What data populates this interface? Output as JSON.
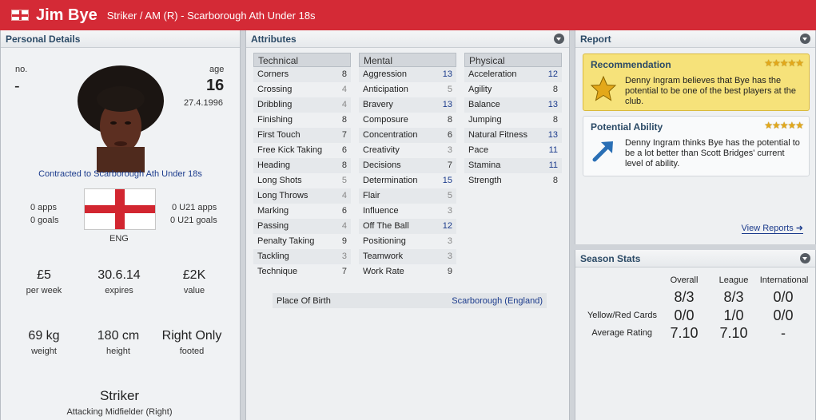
{
  "header": {
    "name": "Jim Bye",
    "subtitle": "Striker / AM (R) - Scarborough Ath Under 18s"
  },
  "personal": {
    "title": "Personal Details",
    "no_label": "no.",
    "no_value": "-",
    "age_label": "age",
    "age_value": "16",
    "dob": "27.4.1996",
    "contract": "Contracted to Scarborough Ath Under 18s",
    "apps": "0 apps",
    "goals": "0 goals",
    "u21_apps": "0 U21 apps",
    "u21_goals": "0 U21 goals",
    "nation": "ENG",
    "wage_value": "£5",
    "wage_label": "per week",
    "expires_value": "30.6.14",
    "expires_label": "expires",
    "value_value": "£2K",
    "value_label": "value",
    "weight_value": "69 kg",
    "weight_label": "weight",
    "height_value": "180 cm",
    "height_label": "height",
    "foot_value": "Right Only",
    "foot_label": "footed",
    "position": "Striker",
    "position_sub": "Attacking Midfielder (Right)"
  },
  "attributes": {
    "title": "Attributes",
    "technical": {
      "label": "Technical",
      "rows": [
        {
          "name": "Corners",
          "value": "8"
        },
        {
          "name": "Crossing",
          "value": "4"
        },
        {
          "name": "Dribbling",
          "value": "4"
        },
        {
          "name": "Finishing",
          "value": "8"
        },
        {
          "name": "First Touch",
          "value": "7"
        },
        {
          "name": "Free Kick Taking",
          "value": "6"
        },
        {
          "name": "Heading",
          "value": "8"
        },
        {
          "name": "Long Shots",
          "value": "5"
        },
        {
          "name": "Long Throws",
          "value": "4"
        },
        {
          "name": "Marking",
          "value": "6"
        },
        {
          "name": "Passing",
          "value": "4"
        },
        {
          "name": "Penalty Taking",
          "value": "9"
        },
        {
          "name": "Tackling",
          "value": "3"
        },
        {
          "name": "Technique",
          "value": "7"
        }
      ]
    },
    "mental": {
      "label": "Mental",
      "rows": [
        {
          "name": "Aggression",
          "value": "13"
        },
        {
          "name": "Anticipation",
          "value": "5"
        },
        {
          "name": "Bravery",
          "value": "13"
        },
        {
          "name": "Composure",
          "value": "8"
        },
        {
          "name": "Concentration",
          "value": "6"
        },
        {
          "name": "Creativity",
          "value": "3"
        },
        {
          "name": "Decisions",
          "value": "7"
        },
        {
          "name": "Determination",
          "value": "15"
        },
        {
          "name": "Flair",
          "value": "5"
        },
        {
          "name": "Influence",
          "value": "3"
        },
        {
          "name": "Off The Ball",
          "value": "12"
        },
        {
          "name": "Positioning",
          "value": "3"
        },
        {
          "name": "Teamwork",
          "value": "3"
        },
        {
          "name": "Work Rate",
          "value": "9"
        }
      ]
    },
    "physical": {
      "label": "Physical",
      "rows": [
        {
          "name": "Acceleration",
          "value": "12"
        },
        {
          "name": "Agility",
          "value": "8"
        },
        {
          "name": "Balance",
          "value": "13"
        },
        {
          "name": "Jumping",
          "value": "8"
        },
        {
          "name": "Natural Fitness",
          "value": "13"
        },
        {
          "name": "Pace",
          "value": "11"
        },
        {
          "name": "Stamina",
          "value": "11"
        },
        {
          "name": "Strength",
          "value": "8"
        }
      ]
    },
    "pob_label": "Place Of Birth",
    "pob_value": "Scarborough (England)"
  },
  "report": {
    "title": "Report",
    "rec_title": "Recommendation",
    "rec_text": "Denny Ingram believes that Bye has the potential to be one of the best players at the club.",
    "pa_title": "Potential Ability",
    "pa_text": "Denny Ingram thinks Bye has the potential to be a lot better than Scott Bridges' current level of ability.",
    "stars": "★★★★★",
    "view_reports": "View Reports ➜"
  },
  "season": {
    "title": "Season Stats",
    "cols": [
      "Overall",
      "League",
      "International"
    ],
    "apps_values": [
      "8/3",
      "8/3",
      "0/0"
    ],
    "cards_label": "Yellow/Red Cards",
    "cards_values": [
      "0/0",
      "1/0",
      "0/0"
    ],
    "rating_label": "Average Rating",
    "rating_values": [
      "7.10",
      "7.10",
      "-"
    ]
  },
  "colors": {
    "title_bar": "#d42a36",
    "link_blue": "#1b3b8c",
    "header_text": "#2b4a66"
  }
}
